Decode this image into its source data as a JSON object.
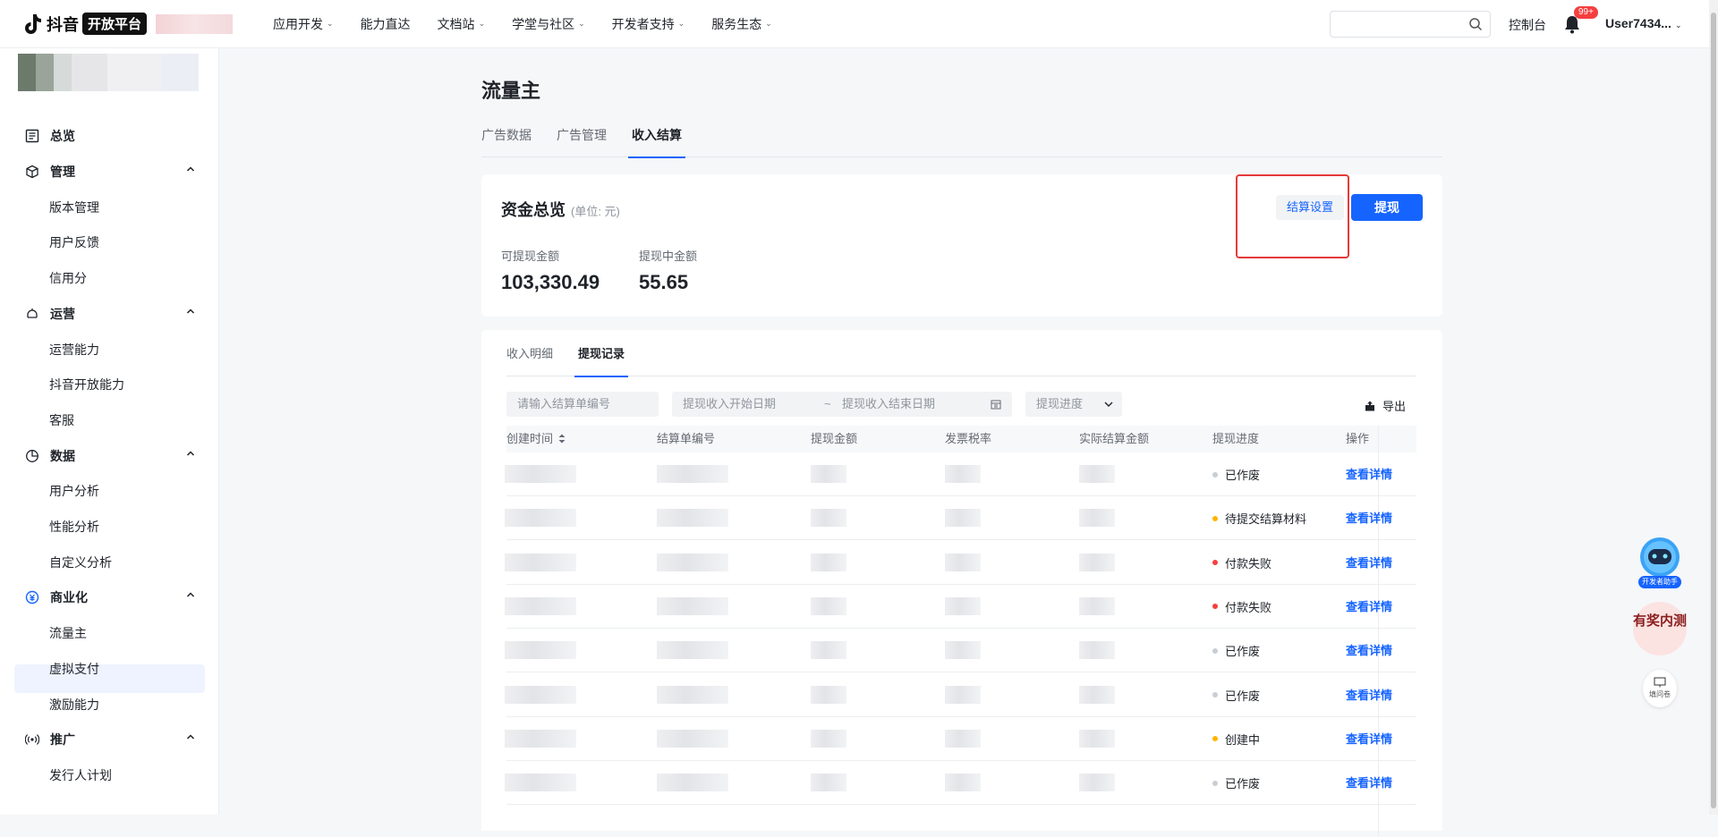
{
  "topbar": {
    "logo_brand": "抖音",
    "logo_badge": "开放平台",
    "nav": [
      "应用开发",
      "能力直达",
      "文档站",
      "学堂与社区",
      "开发者支持",
      "服务生态"
    ],
    "nav_has_chevron": [
      true,
      false,
      true,
      true,
      true,
      true
    ],
    "search_placeholder": "",
    "console": "控制台",
    "bell_badge": "99+",
    "user": "User7434..."
  },
  "sidebar": {
    "overview": "总览",
    "groups": [
      {
        "label": "管理",
        "items": [
          "版本管理",
          "用户反馈",
          "信用分"
        ]
      },
      {
        "label": "运营",
        "items": [
          "运营能力",
          "抖音开放能力",
          "客服"
        ]
      },
      {
        "label": "数据",
        "items": [
          "用户分析",
          "性能分析",
          "自定义分析"
        ]
      },
      {
        "label": "商业化",
        "items": [
          "流量主",
          "虚拟支付",
          "激励能力"
        ]
      },
      {
        "label": "推广",
        "items": [
          "发行人计划"
        ]
      }
    ],
    "active_item": "流量主"
  },
  "main": {
    "title": "流量主",
    "tabs": [
      "广告数据",
      "广告管理",
      "收入结算"
    ],
    "active_tab": "收入结算",
    "fund": {
      "title": "资金总览",
      "unit": "(单位: 元)",
      "settle_button": "结算设置",
      "withdraw_button": "提现",
      "available_label": "可提现金额",
      "available_value": "103,330.49",
      "pending_label": "提现中金额",
      "pending_value": "55.65"
    },
    "records": {
      "subtabs": [
        "收入明细",
        "提现记录"
      ],
      "active_subtab": "提现记录",
      "filter_order_placeholder": "请输入结算单编号",
      "filter_start_placeholder": "提现收入开始日期",
      "filter_sep": "~",
      "filter_end_placeholder": "提现收入结束日期",
      "filter_progress": "提现进度",
      "export": "导出",
      "columns": [
        "创建时间",
        "结算单编号",
        "提现金额",
        "发票税率",
        "实际结算金额",
        "提现进度",
        "操作"
      ],
      "rows": [
        {
          "status": "已作废",
          "status_color": "#c9cdd4",
          "action": "查看详情"
        },
        {
          "status": "待提交结算材料",
          "status_color": "#ffb400",
          "action": "查看详情"
        },
        {
          "status": "付款失败",
          "status_color": "#f53f3f",
          "action": "查看详情"
        },
        {
          "status": "付款失败",
          "status_color": "#f53f3f",
          "action": "查看详情"
        },
        {
          "status": "已作废",
          "status_color": "#c9cdd4",
          "action": "查看详情"
        },
        {
          "status": "已作废",
          "status_color": "#c9cdd4",
          "action": "查看详情"
        },
        {
          "status": "创建中",
          "status_color": "#ffb400",
          "action": "查看详情"
        },
        {
          "status": "已作废",
          "status_color": "#c9cdd4",
          "action": "查看详情"
        }
      ]
    }
  },
  "floating": {
    "assistant": "开发者助手",
    "beta": "有奖内测",
    "survey": "填问卷"
  }
}
